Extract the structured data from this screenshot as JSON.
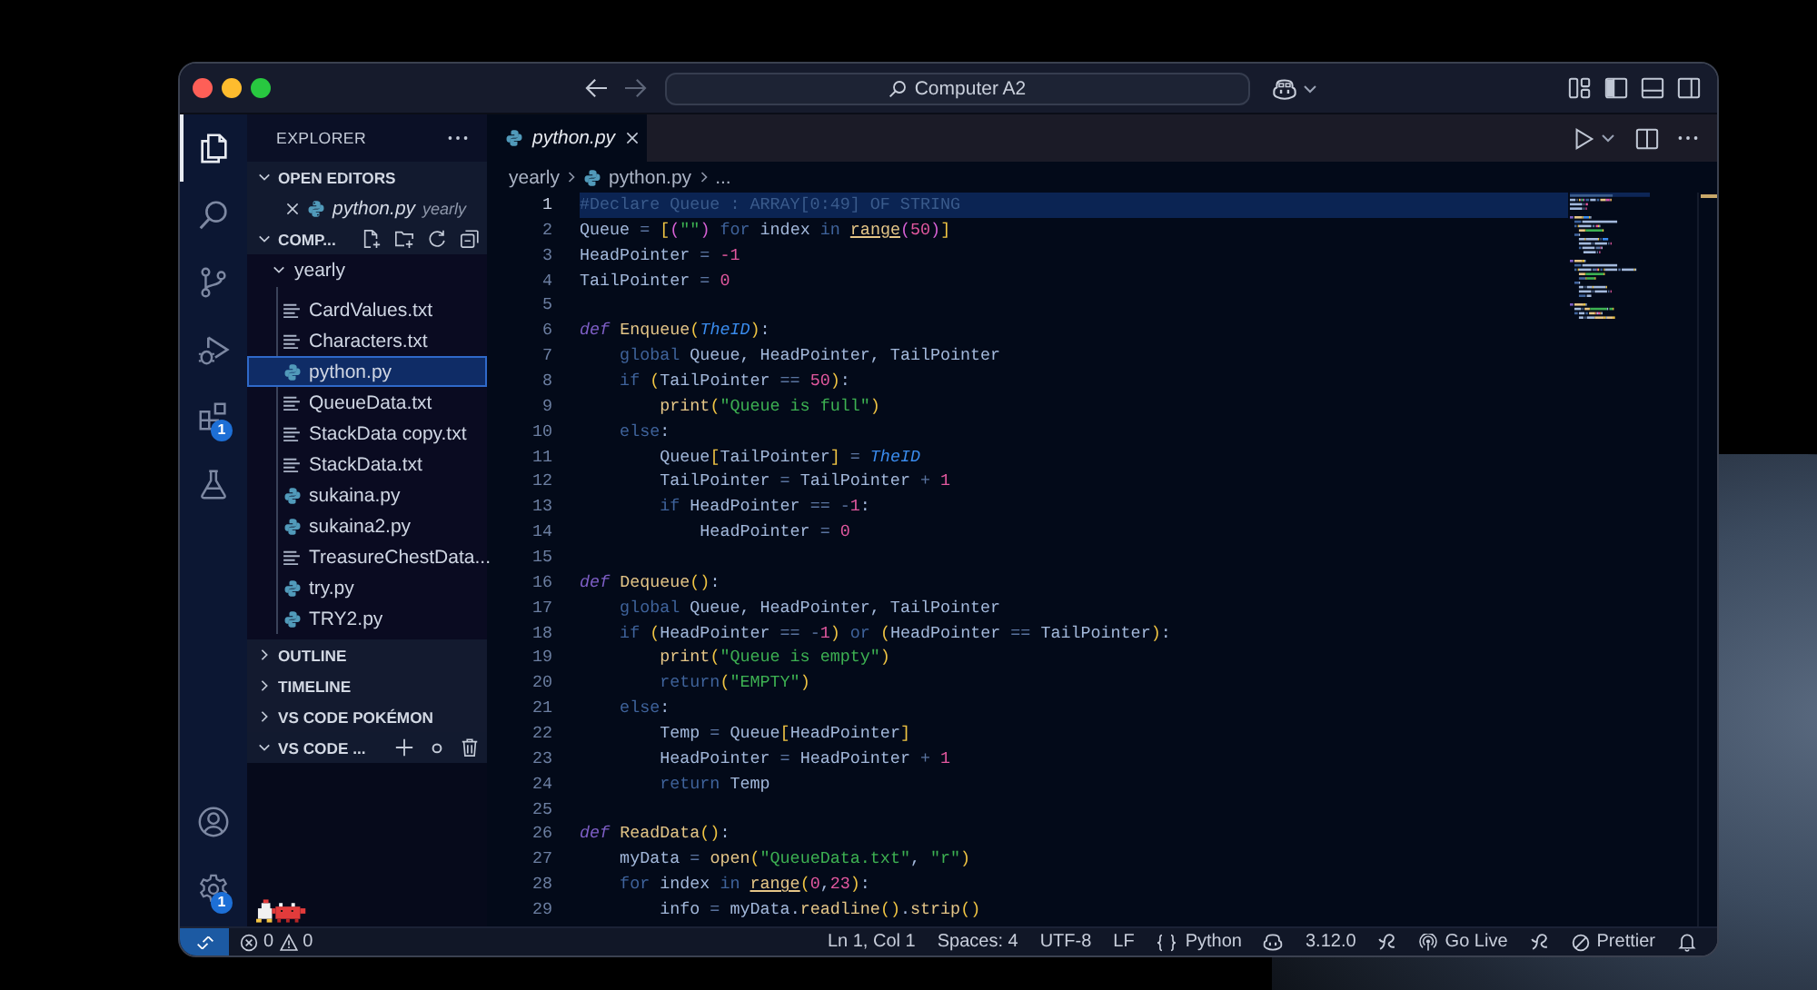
{
  "title_bar": {
    "nav_buttons": [
      {
        "kind": "back",
        "disabled": false
      },
      {
        "kind": "forward",
        "disabled": true
      }
    ],
    "command_center": "Computer A2",
    "layout_toggles": [
      {
        "kind": "sidebar",
        "on": true
      },
      {
        "kind": "panel",
        "on": false
      },
      {
        "kind": "secondary",
        "on": false
      }
    ]
  },
  "activity_bar": {
    "items": [
      {
        "kind": "explorer",
        "selected": true
      },
      {
        "kind": "search",
        "selected": false
      },
      {
        "kind": "scm",
        "selected": false
      },
      {
        "kind": "debug",
        "selected": false
      },
      {
        "kind": "extensions",
        "selected": false,
        "badge": "1"
      },
      {
        "kind": "testing",
        "selected": false
      }
    ],
    "bottom_items": [
      {
        "kind": "accounts"
      },
      {
        "kind": "manage",
        "badge": "1"
      }
    ]
  },
  "sidebar": {
    "title": "EXPLORER",
    "sections": [
      {
        "kind": "editors",
        "title": "OPEN EDITORS",
        "expanded": true,
        "items": [
          {
            "name": "python.py",
            "folder": "yearly",
            "kind": "python"
          }
        ]
      },
      {
        "kind": "folder",
        "title": "COMP...",
        "expanded": true,
        "tree": [
          {
            "name": "yearly",
            "expanded": true,
            "children": [
              {
                "name": "CardValues.txt",
                "kind": "text",
                "selected": false
              },
              {
                "name": "Characters.txt",
                "kind": "text",
                "selected": false
              },
              {
                "name": "python.py",
                "kind": "python",
                "selected": true
              },
              {
                "name": "QueueData.txt",
                "kind": "text",
                "selected": false
              },
              {
                "name": "StackData copy.txt",
                "kind": "text",
                "selected": false
              },
              {
                "name": "StackData.txt",
                "kind": "text",
                "selected": false
              },
              {
                "name": "sukaina.py",
                "kind": "python",
                "selected": false
              },
              {
                "name": "sukaina2.py",
                "kind": "python",
                "selected": false
              },
              {
                "name": "TreasureChestData...",
                "kind": "text",
                "selected": false
              },
              {
                "name": "try.py",
                "kind": "python",
                "selected": false
              },
              {
                "name": "TRY2.py",
                "kind": "python",
                "selected": false
              }
            ]
          }
        ]
      },
      {
        "kind": "view",
        "title": "OUTLINE",
        "expanded": false
      },
      {
        "kind": "view",
        "title": "TIMELINE",
        "expanded": false
      },
      {
        "kind": "view",
        "title": "VS CODE POKÉMON",
        "expanded": false
      },
      {
        "kind": "pets",
        "title": "VS CODE ...",
        "expanded": true
      }
    ]
  },
  "editor": {
    "tabs": [
      {
        "label": "python.py",
        "kind": "python",
        "selected": true
      }
    ],
    "breadcrumb": [
      {
        "label": "yearly",
        "kind": "folder"
      },
      {
        "label": "python.py",
        "kind": "python"
      },
      {
        "label": "...",
        "kind": "more"
      }
    ],
    "lines": [
      {
        "number": "1",
        "highlighted": true,
        "tokens": [
          {
            "text": "#Declare Queue : ARRAY[0:49] OF STRING",
            "kind": "comment"
          }
        ]
      },
      {
        "number": "2",
        "highlighted": false,
        "tokens": [
          {
            "text": "Queue",
            "kind": "plain"
          },
          {
            "text": " = ",
            "kind": "op"
          },
          {
            "text": "[",
            "kind": "bracket"
          },
          {
            "text": "(",
            "kind": "bracket2"
          },
          {
            "text": "\"\"",
            "kind": "string"
          },
          {
            "text": ")",
            "kind": "bracket2"
          },
          {
            "text": " for ",
            "kind": "keyword"
          },
          {
            "text": "index",
            "kind": "plain"
          },
          {
            "text": " in ",
            "kind": "keyword"
          },
          {
            "text": "range",
            "kind": "builtin"
          },
          {
            "text": "(",
            "kind": "bracket2"
          },
          {
            "text": "50",
            "kind": "number"
          },
          {
            "text": ")",
            "kind": "bracket2"
          },
          {
            "text": "]",
            "kind": "bracket"
          }
        ]
      },
      {
        "number": "3",
        "highlighted": false,
        "tokens": [
          {
            "text": "HeadPointer",
            "kind": "plain"
          },
          {
            "text": " = ",
            "kind": "op"
          },
          {
            "text": "-1",
            "kind": "number"
          }
        ]
      },
      {
        "number": "4",
        "highlighted": false,
        "tokens": [
          {
            "text": "TailPointer",
            "kind": "plain"
          },
          {
            "text": " = ",
            "kind": "op"
          },
          {
            "text": "0",
            "kind": "number"
          }
        ]
      },
      {
        "number": "5",
        "highlighted": false
      },
      {
        "number": "6",
        "highlighted": false,
        "tokens": [
          {
            "text": "def ",
            "kind": "def"
          },
          {
            "text": "Enqueue",
            "kind": "func"
          },
          {
            "text": "(",
            "kind": "bracket"
          },
          {
            "text": "TheID",
            "kind": "param"
          },
          {
            "text": ")",
            "kind": "bracket"
          },
          {
            "text": ":",
            "kind": "plain"
          }
        ]
      },
      {
        "number": "7",
        "highlighted": false,
        "tokens": [
          {
            "text": "    global ",
            "kind": "keyword"
          },
          {
            "text": "Queue, HeadPointer, TailPointer",
            "kind": "plain"
          }
        ]
      },
      {
        "number": "8",
        "highlighted": false,
        "tokens": [
          {
            "text": "    if ",
            "kind": "keyword"
          },
          {
            "text": "(",
            "kind": "bracket"
          },
          {
            "text": "TailPointer",
            "kind": "plain"
          },
          {
            "text": " == ",
            "kind": "op"
          },
          {
            "text": "50",
            "kind": "number"
          },
          {
            "text": ")",
            "kind": "bracket"
          },
          {
            "text": ":",
            "kind": "plain"
          }
        ]
      },
      {
        "number": "9",
        "highlighted": false,
        "tokens": [
          {
            "text": "        print",
            "kind": "func"
          },
          {
            "text": "(",
            "kind": "bracket"
          },
          {
            "text": "\"Queue is full\"",
            "kind": "string"
          },
          {
            "text": ")",
            "kind": "bracket"
          }
        ]
      },
      {
        "number": "10",
        "highlighted": false,
        "tokens": [
          {
            "text": "    else",
            "kind": "keyword"
          },
          {
            "text": ":",
            "kind": "plain"
          }
        ]
      },
      {
        "number": "11",
        "highlighted": false,
        "tokens": [
          {
            "text": "        Queue",
            "kind": "plain"
          },
          {
            "text": "[",
            "kind": "bracket"
          },
          {
            "text": "TailPointer",
            "kind": "plain"
          },
          {
            "text": "]",
            "kind": "bracket"
          },
          {
            "text": " = ",
            "kind": "op"
          },
          {
            "text": "TheID",
            "kind": "param"
          }
        ]
      },
      {
        "number": "12",
        "highlighted": false,
        "tokens": [
          {
            "text": "        TailPointer",
            "kind": "plain"
          },
          {
            "text": " = ",
            "kind": "op"
          },
          {
            "text": "TailPointer",
            "kind": "plain"
          },
          {
            "text": " + ",
            "kind": "op"
          },
          {
            "text": "1",
            "kind": "number"
          }
        ]
      },
      {
        "number": "13",
        "highlighted": false,
        "tokens": [
          {
            "text": "        if ",
            "kind": "keyword"
          },
          {
            "text": "HeadPointer",
            "kind": "plain"
          },
          {
            "text": " == -",
            "kind": "op"
          },
          {
            "text": "1",
            "kind": "number"
          },
          {
            "text": ":",
            "kind": "plain"
          }
        ]
      },
      {
        "number": "14",
        "highlighted": false,
        "tokens": [
          {
            "text": "            HeadPointer",
            "kind": "plain"
          },
          {
            "text": " = ",
            "kind": "op"
          },
          {
            "text": "0",
            "kind": "number"
          }
        ]
      },
      {
        "number": "15",
        "highlighted": false
      },
      {
        "number": "16",
        "highlighted": false,
        "tokens": [
          {
            "text": "def ",
            "kind": "def"
          },
          {
            "text": "Dequeue",
            "kind": "func"
          },
          {
            "text": "()",
            "kind": "bracket"
          },
          {
            "text": ":",
            "kind": "plain"
          }
        ]
      },
      {
        "number": "17",
        "highlighted": false,
        "tokens": [
          {
            "text": "    global ",
            "kind": "keyword"
          },
          {
            "text": "Queue, HeadPointer, TailPointer",
            "kind": "plain"
          }
        ]
      },
      {
        "number": "18",
        "highlighted": false,
        "tokens": [
          {
            "text": "    if ",
            "kind": "keyword"
          },
          {
            "text": "(",
            "kind": "bracket"
          },
          {
            "text": "HeadPointer",
            "kind": "plain"
          },
          {
            "text": " == -",
            "kind": "op"
          },
          {
            "text": "1",
            "kind": "number"
          },
          {
            "text": ")",
            "kind": "bracket"
          },
          {
            "text": " or ",
            "kind": "keyword"
          },
          {
            "text": "(",
            "kind": "bracket"
          },
          {
            "text": "HeadPointer",
            "kind": "plain"
          },
          {
            "text": " == ",
            "kind": "op"
          },
          {
            "text": "TailPointer",
            "kind": "plain"
          },
          {
            "text": ")",
            "kind": "bracket"
          },
          {
            "text": ":",
            "kind": "plain"
          }
        ]
      },
      {
        "number": "19",
        "highlighted": false,
        "tokens": [
          {
            "text": "        print",
            "kind": "func"
          },
          {
            "text": "(",
            "kind": "bracket"
          },
          {
            "text": "\"Queue is empty\"",
            "kind": "string"
          },
          {
            "text": ")",
            "kind": "bracket"
          }
        ]
      },
      {
        "number": "20",
        "highlighted": false,
        "tokens": [
          {
            "text": "        return",
            "kind": "keyword"
          },
          {
            "text": "(",
            "kind": "bracket"
          },
          {
            "text": "\"EMPTY\"",
            "kind": "string"
          },
          {
            "text": ")",
            "kind": "bracket"
          }
        ]
      },
      {
        "number": "21",
        "highlighted": false,
        "tokens": [
          {
            "text": "    else",
            "kind": "keyword"
          },
          {
            "text": ":",
            "kind": "plain"
          }
        ]
      },
      {
        "number": "22",
        "highlighted": false,
        "tokens": [
          {
            "text": "        Temp",
            "kind": "plain"
          },
          {
            "text": " = ",
            "kind": "op"
          },
          {
            "text": "Queue",
            "kind": "plain"
          },
          {
            "text": "[",
            "kind": "bracket"
          },
          {
            "text": "HeadPointer",
            "kind": "plain"
          },
          {
            "text": "]",
            "kind": "bracket"
          }
        ]
      },
      {
        "number": "23",
        "highlighted": false,
        "tokens": [
          {
            "text": "        HeadPointer",
            "kind": "plain"
          },
          {
            "text": " = ",
            "kind": "op"
          },
          {
            "text": "HeadPointer",
            "kind": "plain"
          },
          {
            "text": " + ",
            "kind": "op"
          },
          {
            "text": "1",
            "kind": "number"
          }
        ]
      },
      {
        "number": "24",
        "highlighted": false,
        "tokens": [
          {
            "text": "        return ",
            "kind": "keyword"
          },
          {
            "text": "Temp",
            "kind": "plain"
          }
        ]
      },
      {
        "number": "25",
        "highlighted": false
      },
      {
        "number": "26",
        "highlighted": false,
        "tokens": [
          {
            "text": "def ",
            "kind": "def"
          },
          {
            "text": "ReadData",
            "kind": "func"
          },
          {
            "text": "()",
            "kind": "bracket"
          },
          {
            "text": ":",
            "kind": "plain"
          }
        ]
      },
      {
        "number": "27",
        "highlighted": false,
        "tokens": [
          {
            "text": "    myData",
            "kind": "plain"
          },
          {
            "text": " = ",
            "kind": "op"
          },
          {
            "text": "open",
            "kind": "func"
          },
          {
            "text": "(",
            "kind": "bracket"
          },
          {
            "text": "\"QueueData.txt\"",
            "kind": "string"
          },
          {
            "text": ", ",
            "kind": "plain"
          },
          {
            "text": "\"r\"",
            "kind": "string"
          },
          {
            "text": ")",
            "kind": "bracket"
          }
        ]
      },
      {
        "number": "28",
        "highlighted": false,
        "tokens": [
          {
            "text": "    for ",
            "kind": "keyword"
          },
          {
            "text": "index",
            "kind": "plain"
          },
          {
            "text": " in ",
            "kind": "keyword"
          },
          {
            "text": "range",
            "kind": "builtin"
          },
          {
            "text": "(",
            "kind": "bracket"
          },
          {
            "text": "0",
            "kind": "number"
          },
          {
            "text": ",",
            "kind": "plain"
          },
          {
            "text": "23",
            "kind": "number"
          },
          {
            "text": ")",
            "kind": "bracket"
          },
          {
            "text": ":",
            "kind": "plain"
          }
        ]
      },
      {
        "number": "29",
        "highlighted": false,
        "tokens": [
          {
            "text": "        info",
            "kind": "plain"
          },
          {
            "text": " = ",
            "kind": "op"
          },
          {
            "text": "myData",
            "kind": "plain"
          },
          {
            "text": ".",
            "kind": "plain"
          },
          {
            "text": "readline",
            "kind": "func"
          },
          {
            "text": "()",
            "kind": "bracket"
          },
          {
            "text": ".",
            "kind": "plain"
          },
          {
            "text": "strip",
            "kind": "func"
          },
          {
            "text": "()",
            "kind": "bracket"
          }
        ]
      }
    ]
  },
  "status_bar": {
    "errors": "0",
    "warnings": "0",
    "items": [
      {
        "kind": "text",
        "text": "Ln 1, Col 1"
      },
      {
        "kind": "text",
        "text": "Spaces: 4"
      },
      {
        "kind": "text",
        "text": "UTF-8"
      },
      {
        "kind": "text",
        "text": "LF"
      },
      {
        "kind": "language",
        "text": "Python"
      },
      {
        "kind": "copilot"
      },
      {
        "kind": "text",
        "text": "3.12.0"
      },
      {
        "kind": "swirl"
      },
      {
        "kind": "live",
        "text": "Go Live"
      },
      {
        "kind": "swirl"
      },
      {
        "kind": "formatter",
        "text": "Prettier"
      },
      {
        "kind": "bell"
      }
    ]
  }
}
